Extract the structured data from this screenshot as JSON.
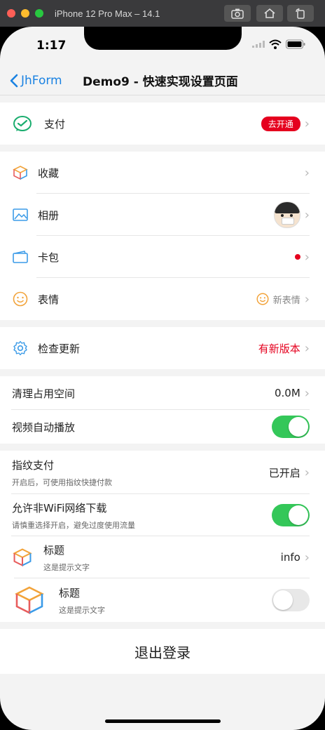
{
  "simulator": {
    "title": "iPhone 12 Pro Max – 14.1"
  },
  "status": {
    "time": "1:17"
  },
  "nav": {
    "back_label": "JhForm",
    "title": "Demo9 - 快速实现设置页面"
  },
  "rows": {
    "pay": {
      "label": "支付",
      "badge": "去开通"
    },
    "favorite": {
      "label": "收藏"
    },
    "album": {
      "label": "相册"
    },
    "cards": {
      "label": "卡包"
    },
    "emoji": {
      "label": "表情",
      "value": "新表情"
    },
    "update": {
      "label": "检查更新",
      "value": "有新版本"
    },
    "clear": {
      "label": "清理占用空间",
      "value": "0.0M"
    },
    "autoplay": {
      "label": "视频自动播放",
      "on": true
    },
    "fingerprint": {
      "label": "指纹支付",
      "sub": "开启后，可使用指纹快捷付款",
      "value": "已开启"
    },
    "wifi": {
      "label": "允许非WiFi网络下载",
      "sub": "请慎重选择开启，避免过度使用流量",
      "on": true
    },
    "title1": {
      "label": "标题",
      "sub": "这是提示文字",
      "value": "info"
    },
    "title2": {
      "label": "标题",
      "sub": "这是提示文字",
      "on": false
    },
    "logout": {
      "label": "退出登录"
    }
  },
  "colors": {
    "accent": "#1a82e2",
    "red": "#e5001e",
    "switch_on": "#34c759"
  }
}
